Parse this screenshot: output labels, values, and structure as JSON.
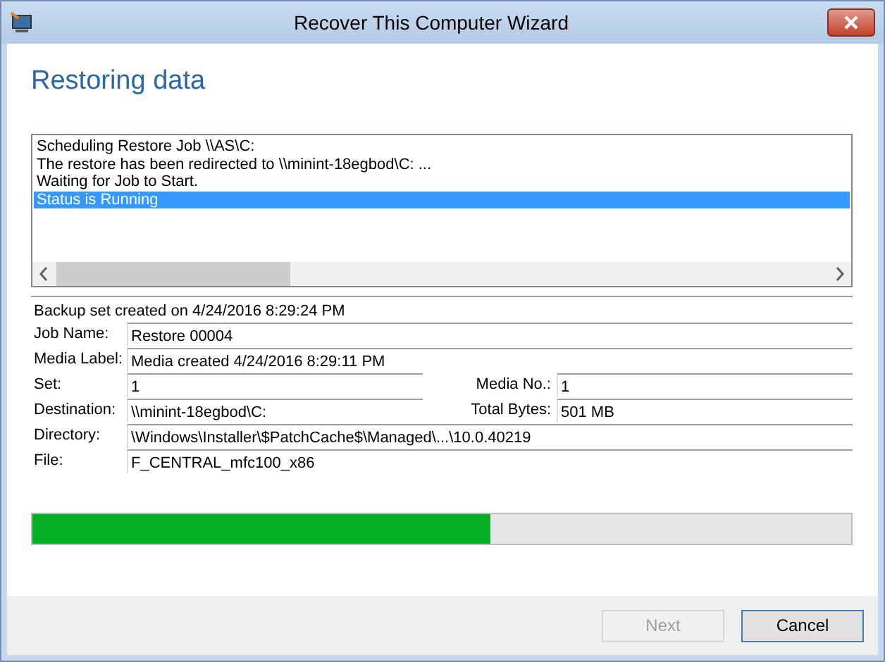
{
  "window": {
    "title": "Recover This Computer Wizard"
  },
  "heading": "Restoring data",
  "log": {
    "lines": [
      {
        "text": "Scheduling Restore Job \\\\AS\\C:",
        "selected": false
      },
      {
        "text": "The restore has been redirected to \\\\minint-18egbod\\C: ...",
        "selected": false
      },
      {
        "text": "Waiting for Job to Start.",
        "selected": false
      },
      {
        "text": "Status is Running",
        "selected": true
      }
    ]
  },
  "backup_set": "Backup set created on 4/24/2016 8:29:24 PM",
  "rows": [
    [
      {
        "label": "Job Name:",
        "value": "Restore 00004"
      }
    ],
    [
      {
        "label": "Media Label:",
        "value": "Media created 4/24/2016 8:29:11 PM"
      }
    ],
    [
      {
        "label": "Set:",
        "value": "1"
      },
      {
        "label": "Media No.:",
        "value": "1"
      }
    ],
    [
      {
        "label": "Destination:",
        "value": "\\\\minint-18egbod\\C:"
      },
      {
        "label": "Total Bytes:",
        "value": "501 MB"
      }
    ],
    [
      {
        "label": "Directory:",
        "value": "\\Windows\\Installer\\$PatchCache$\\Managed\\...\\10.0.40219"
      }
    ],
    [
      {
        "label": "File:",
        "value": "F_CENTRAL_mfc100_x86"
      }
    ]
  ],
  "progress": {
    "level": 0.56
  },
  "buttons": [
    {
      "label": "Next",
      "disabled": true
    },
    {
      "label": "Cancel",
      "disabled": false
    }
  ]
}
